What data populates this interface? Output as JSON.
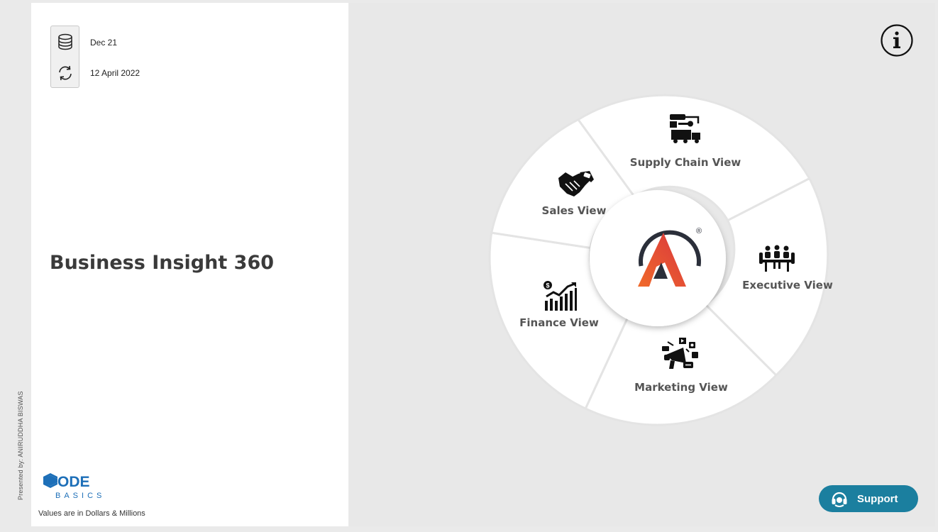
{
  "sidebar": {
    "presented_by": "Presented by: ANIRUDDHA BISWAS"
  },
  "info": {
    "data_period": "Dec 21",
    "refresh_date": "12 April 2022"
  },
  "report": {
    "title": "Business Insight 360"
  },
  "brand": {
    "logo_line1": "ODE",
    "logo_line2": "BASICS",
    "note": "Values are in Dollars & Millions"
  },
  "nav": {
    "supply_chain": "Supply Chain View",
    "sales": "Sales View",
    "executive": "Executive View",
    "finance": "Finance View",
    "marketing": "Marketing View",
    "center_mark": "®"
  },
  "support": {
    "label": "Support"
  },
  "colors": {
    "accent": "#1b7f9f",
    "logo_blue": "#1d6fb8",
    "logo_orange": "#e8572a",
    "logo_dark": "#2b2f3a"
  },
  "icons": {
    "data_period": "database-icon",
    "refresh": "refresh-icon",
    "info": "info-icon",
    "supply_chain": "supply-chain-icon",
    "sales": "handshake-icon",
    "executive": "meeting-icon",
    "finance": "finance-chart-icon",
    "marketing": "megaphone-icon",
    "support": "headset-icon"
  }
}
